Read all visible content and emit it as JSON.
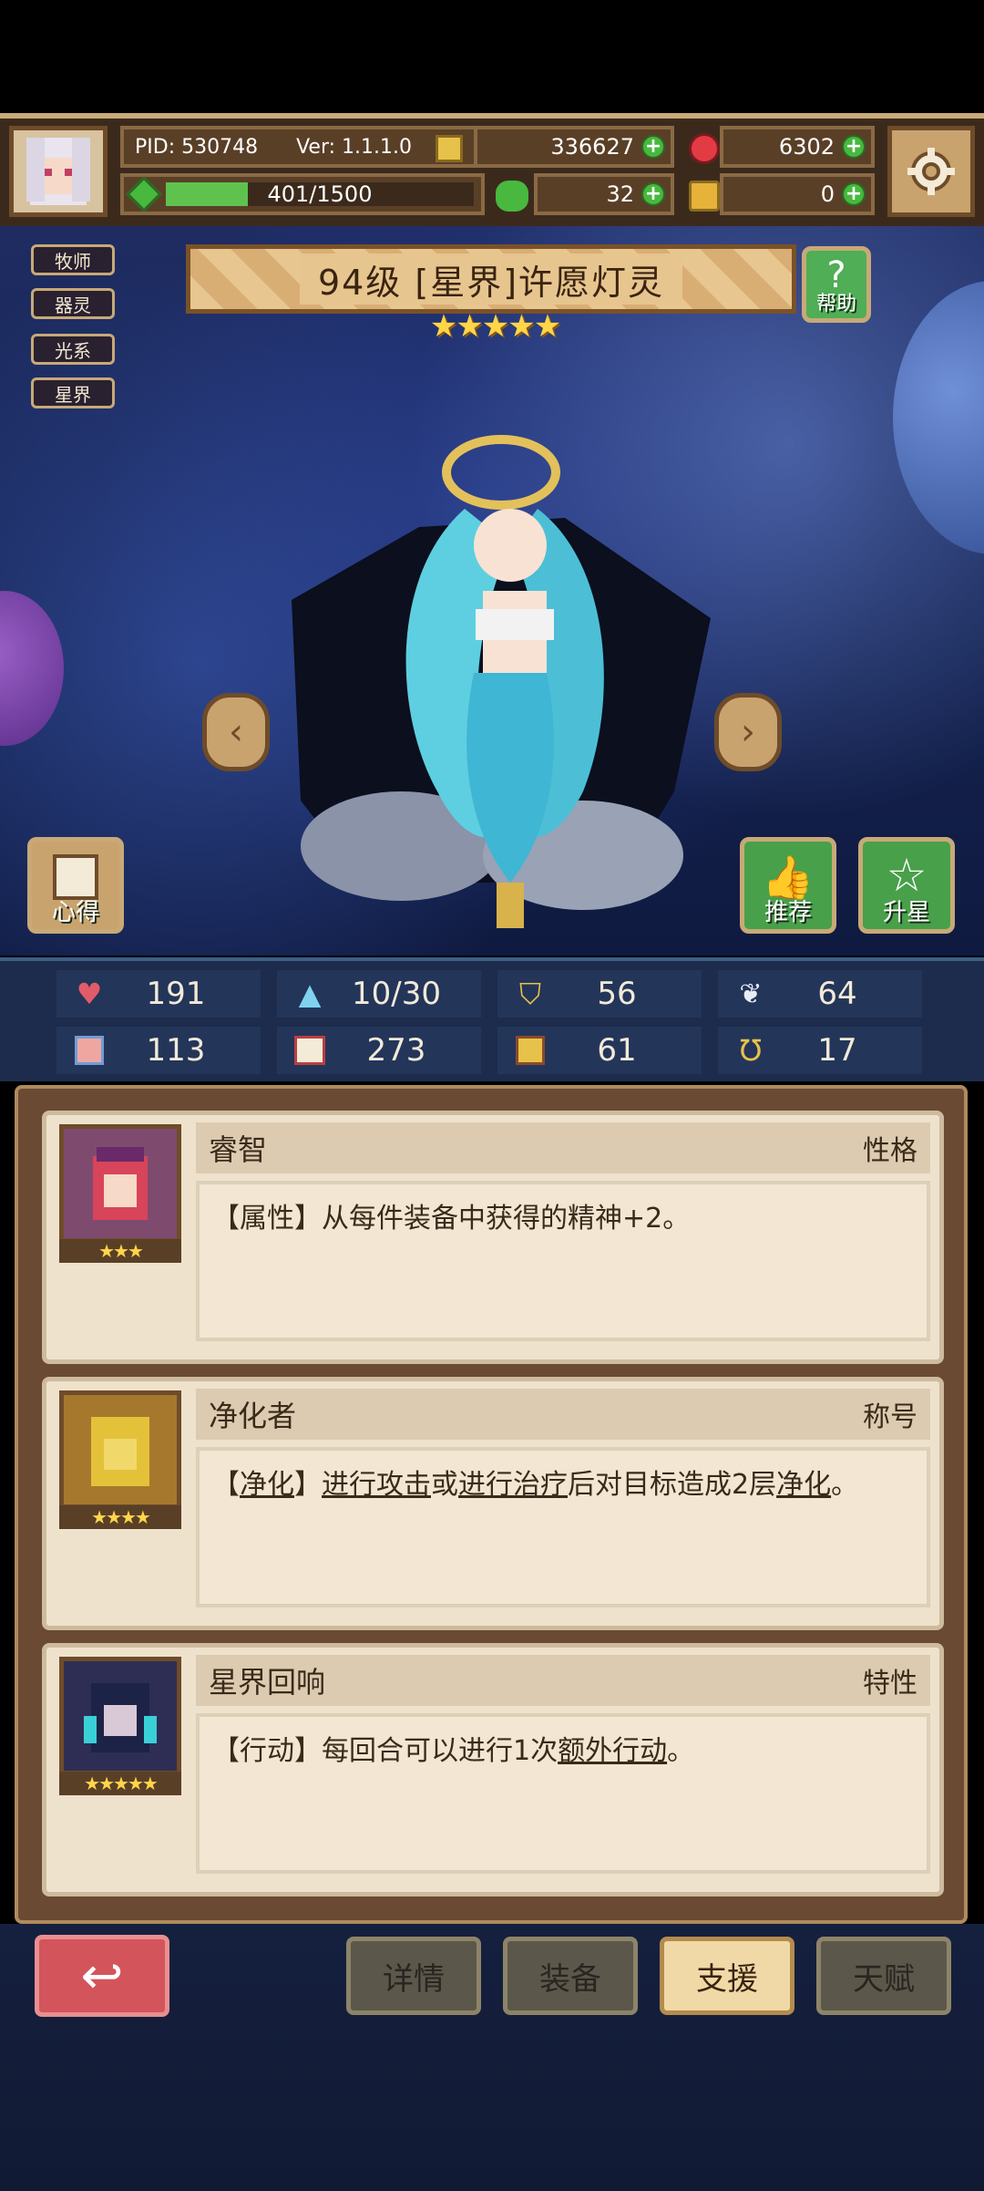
{
  "topbar": {
    "pid": "PID: 530748",
    "version": "Ver: 1.1.1.0",
    "gold": "336627",
    "gems": "6302",
    "energy": "401/1500",
    "energy_fraction": 0.267,
    "clover": "32",
    "bag": "0"
  },
  "hero": {
    "title": "94级 [星界]许愿灯灵",
    "stars": "★★★★★",
    "tags": [
      "牧师",
      "器灵",
      "光系",
      "星界"
    ],
    "help_label": "帮助",
    "notes_label": "心得",
    "recommend_label": "推荐",
    "star_up_label": "升星"
  },
  "stats": [
    {
      "icon": "heart-icon",
      "value": "191"
    },
    {
      "icon": "drop-icon",
      "value": "10/30"
    },
    {
      "icon": "shield-icon",
      "value": "56"
    },
    {
      "icon": "wing-icon",
      "value": "64"
    },
    {
      "icon": "fist-icon",
      "value": "113"
    },
    {
      "icon": "book-icon",
      "value": "273"
    },
    {
      "icon": "boot-icon",
      "value": "61"
    },
    {
      "icon": "horseshoe-icon",
      "value": "17"
    }
  ],
  "cards": [
    {
      "name": "睿智",
      "type": "性格",
      "stars": "★★★",
      "prefix": "【属性】从每件装备中获得的精神+2。"
    },
    {
      "name": "净化者",
      "type": "称号",
      "stars": "★★★★",
      "seg1": "【",
      "seg2": "净化",
      "seg3": "】",
      "seg4": "进行攻击",
      "seg5": "或",
      "seg6": "进行治疗",
      "seg7": "后对目标造成2层",
      "seg8": "净化",
      "seg9": "。"
    },
    {
      "name": "星界回响",
      "type": "特性",
      "stars": "★★★★★",
      "seg1": "【行动】每回合可以进行1次",
      "seg2": "额外行动",
      "seg3": "。"
    }
  ],
  "nav": {
    "back_icon": "↩",
    "tabs": [
      "详情",
      "装备",
      "支援",
      "天赋"
    ],
    "active_tab": "支援"
  },
  "colors": {
    "accent_green": "#48b83e",
    "frame_gold": "#c8a977",
    "back_red": "#d4545b"
  }
}
